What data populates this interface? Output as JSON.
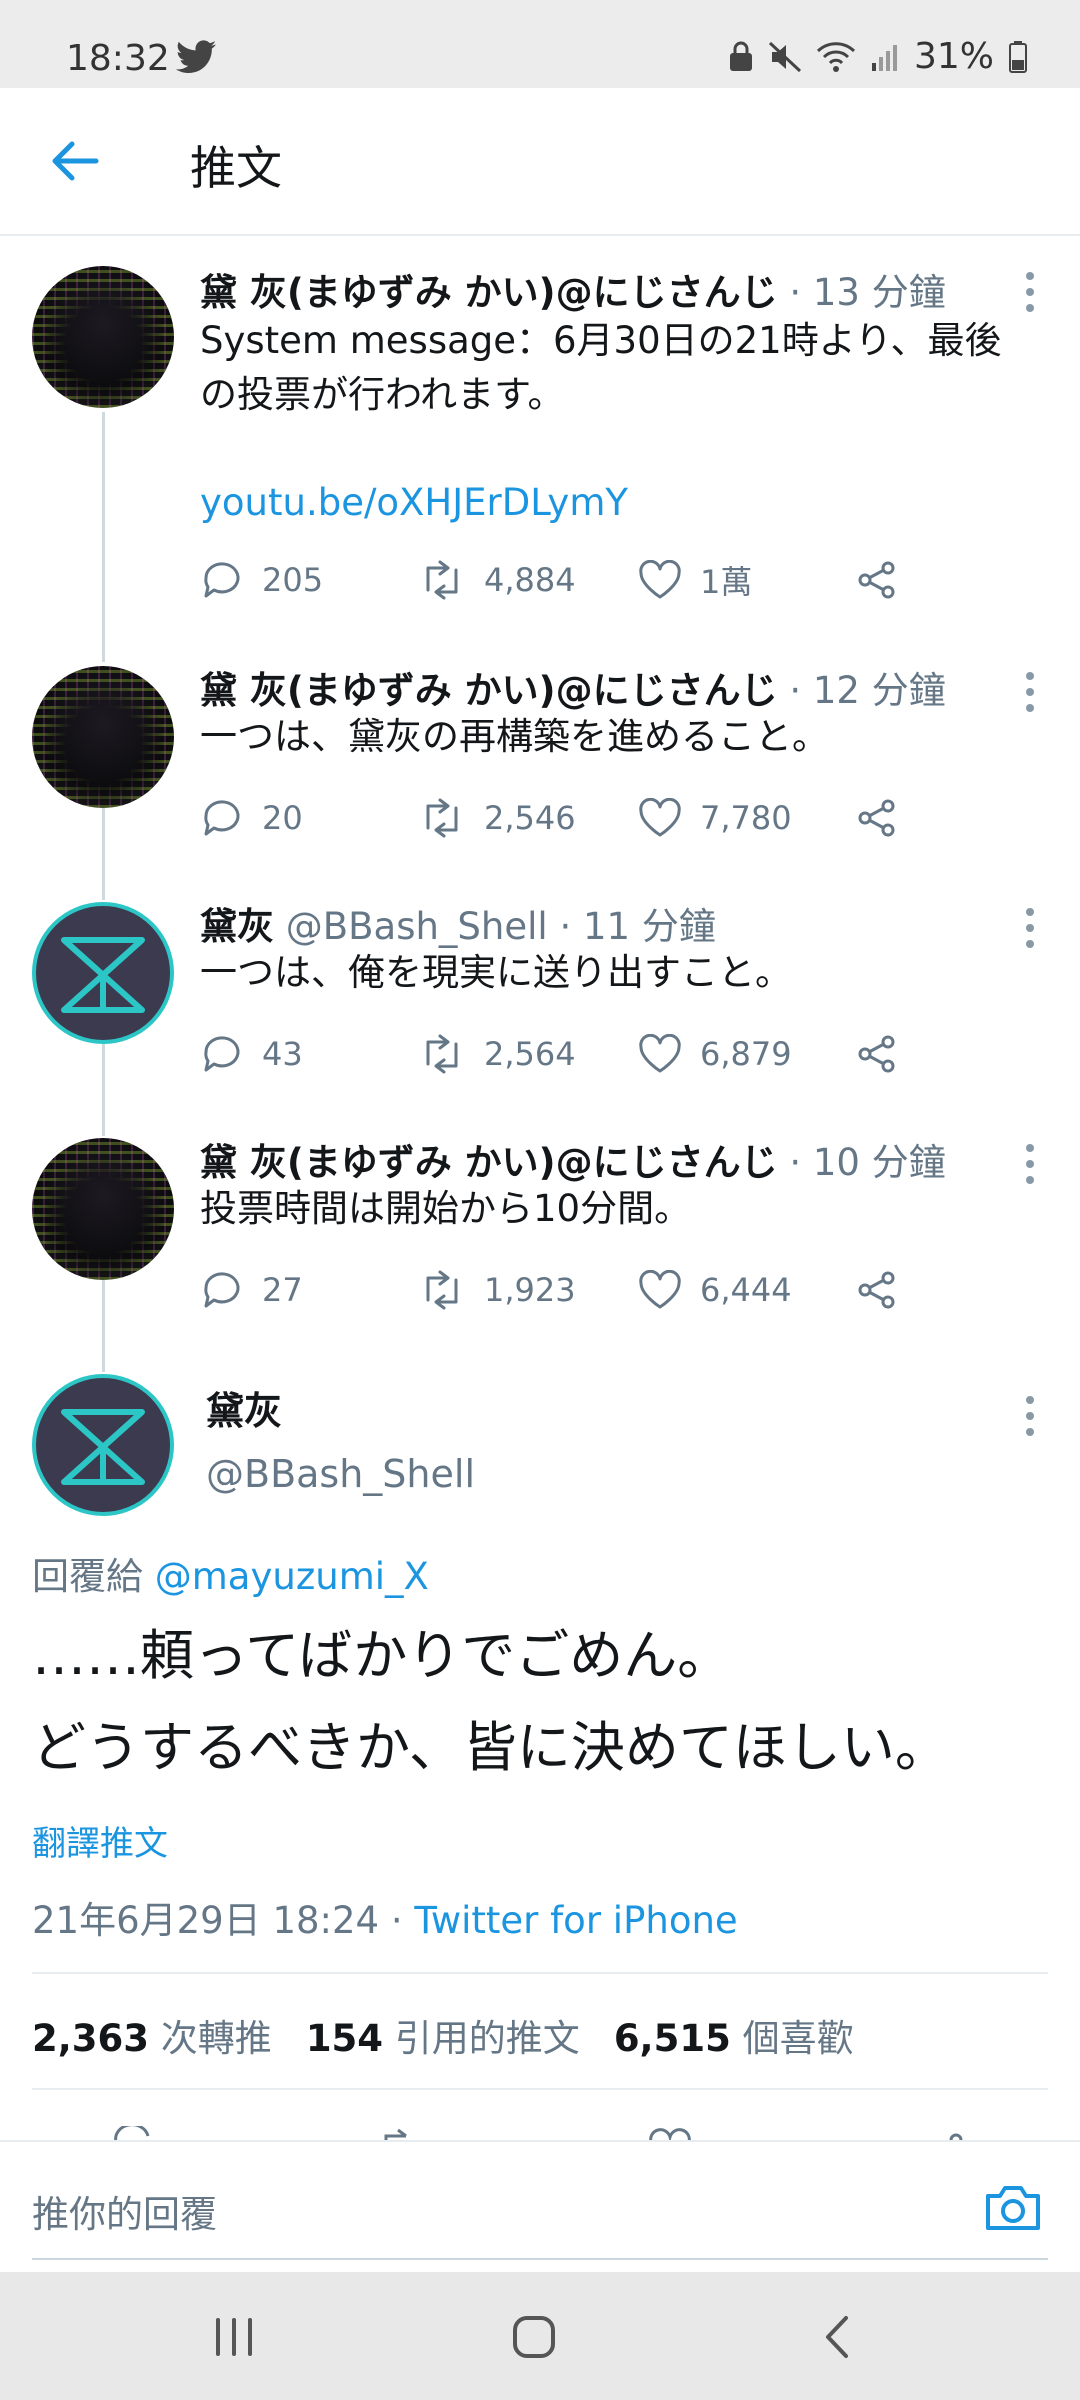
{
  "status_bar": {
    "time": "18:32",
    "battery": "31%"
  },
  "app_bar": {
    "title": "推文"
  },
  "thread": [
    {
      "name": "黛 灰(まゆずみ かい)@にじさんじ",
      "meta": " · 13 分鐘",
      "text_lines": [
        "System message：6月30日の21時より、最後",
        "の投票が行われます。"
      ],
      "link": "youtu.be/oXHJErDLymY",
      "replies": "205",
      "retweets": "4,884",
      "likes": "1萬"
    },
    {
      "name": "黛 灰(まゆずみ かい)@にじさんじ",
      "meta": " · 12 分鐘",
      "text_lines": [
        "一つは、黛灰の再構築を進めること。"
      ],
      "replies": "20",
      "retweets": "2,546",
      "likes": "7,780"
    },
    {
      "name": "黛灰",
      "meta": " @BBash_Shell · 11 分鐘",
      "text_lines": [
        "一つは、俺を現実に送り出すこと。"
      ],
      "replies": "43",
      "retweets": "2,564",
      "likes": "6,879"
    },
    {
      "name": "黛 灰(まゆずみ かい)@にじさんじ",
      "meta": " · 10 分鐘",
      "text_lines": [
        "投票時間は開始から10分間。"
      ],
      "replies": "27",
      "retweets": "1,923",
      "likes": "6,444"
    }
  ],
  "main_tweet": {
    "name": "黛灰",
    "handle": "@BBash_Shell",
    "reply_prefix": "回覆給",
    "reply_to": "@mayuzumi_X",
    "text_lines": [
      "……頼ってばかりでごめん。",
      "どうするべきか、皆に決めてほしい。"
    ],
    "translate": "翻譯推文",
    "date": "21年6月29日 18:24 · ",
    "source": "Twitter for iPhone",
    "stats": {
      "retweets": "2,363",
      "retweets_label": " 次轉推",
      "quotes": "154",
      "quotes_label": " 引用的推文",
      "likes": "6,515",
      "likes_label": " 個喜歡"
    }
  },
  "composer": {
    "placeholder": "推你的回覆"
  },
  "icons": [
    "twitter-bird-icon",
    "back-arrow-icon",
    "reply-icon",
    "retweet-icon",
    "like-icon",
    "share-icon",
    "more-icon",
    "camera-icon",
    "recents-icon",
    "home-icon",
    "nav-back-icon"
  ],
  "colors": {
    "accent": "#1b95e0",
    "muted": "#657786",
    "text": "#14171a",
    "divider": "#e6ecf0"
  }
}
